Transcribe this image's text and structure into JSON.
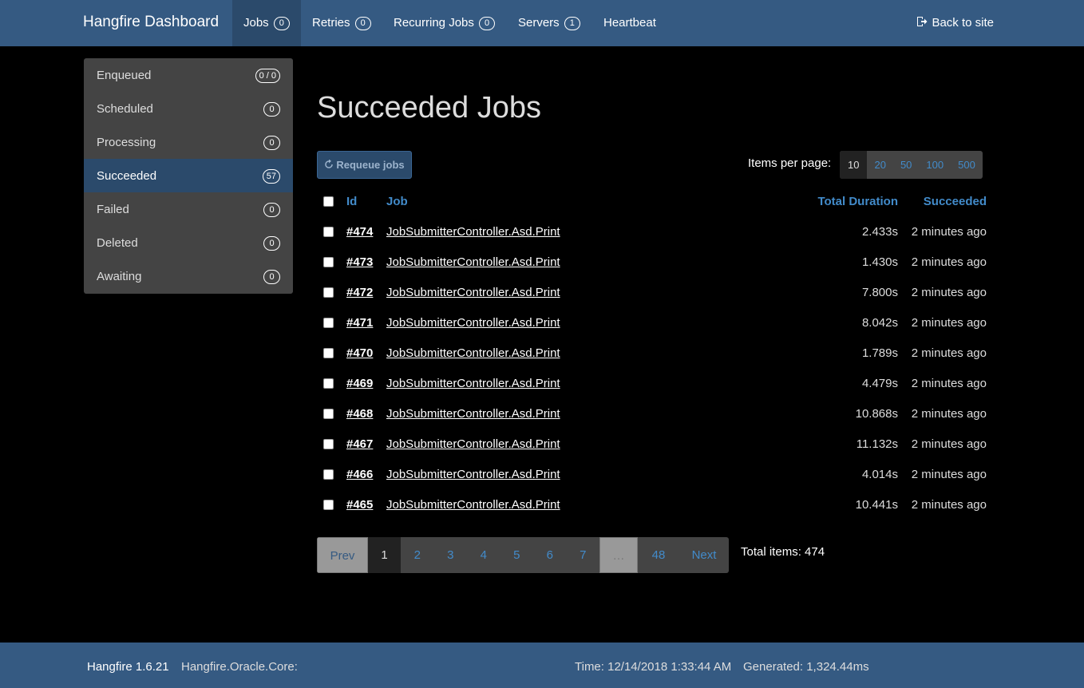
{
  "navbar": {
    "brand": "Hangfire Dashboard",
    "items": [
      {
        "label": "Jobs",
        "count": "0"
      },
      {
        "label": "Retries",
        "count": "0"
      },
      {
        "label": "Recurring Jobs",
        "count": "0"
      },
      {
        "label": "Servers",
        "count": "1"
      },
      {
        "label": "Heartbeat"
      }
    ],
    "back_label": "Back to site"
  },
  "sidebar": {
    "items": [
      {
        "label": "Enqueued",
        "count": "0 / 0"
      },
      {
        "label": "Scheduled",
        "count": "0"
      },
      {
        "label": "Processing",
        "count": "0"
      },
      {
        "label": "Succeeded",
        "count": "57"
      },
      {
        "label": "Failed",
        "count": "0"
      },
      {
        "label": "Deleted",
        "count": "0"
      },
      {
        "label": "Awaiting",
        "count": "0"
      }
    ]
  },
  "main": {
    "title": "Succeeded Jobs",
    "requeue_label": "Requeue jobs",
    "items_per_page_label": "Items per page:",
    "page_sizes": [
      "10",
      "20",
      "50",
      "100",
      "500"
    ],
    "table": {
      "headers": {
        "id": "Id",
        "job": "Job",
        "duration": "Total Duration",
        "succeeded": "Succeeded"
      },
      "rows": [
        {
          "id": "#474",
          "job": "JobSubmitterController.Asd.Print",
          "duration": "2.433s",
          "succeeded": "2 minutes ago"
        },
        {
          "id": "#473",
          "job": "JobSubmitterController.Asd.Print",
          "duration": "1.430s",
          "succeeded": "2 minutes ago"
        },
        {
          "id": "#472",
          "job": "JobSubmitterController.Asd.Print",
          "duration": "7.800s",
          "succeeded": "2 minutes ago"
        },
        {
          "id": "#471",
          "job": "JobSubmitterController.Asd.Print",
          "duration": "8.042s",
          "succeeded": "2 minutes ago"
        },
        {
          "id": "#470",
          "job": "JobSubmitterController.Asd.Print",
          "duration": "1.789s",
          "succeeded": "2 minutes ago"
        },
        {
          "id": "#469",
          "job": "JobSubmitterController.Asd.Print",
          "duration": "4.479s",
          "succeeded": "2 minutes ago"
        },
        {
          "id": "#468",
          "job": "JobSubmitterController.Asd.Print",
          "duration": "10.868s",
          "succeeded": "2 minutes ago"
        },
        {
          "id": "#467",
          "job": "JobSubmitterController.Asd.Print",
          "duration": "11.132s",
          "succeeded": "2 minutes ago"
        },
        {
          "id": "#466",
          "job": "JobSubmitterController.Asd.Print",
          "duration": "4.014s",
          "succeeded": "2 minutes ago"
        },
        {
          "id": "#465",
          "job": "JobSubmitterController.Asd.Print",
          "duration": "10.441s",
          "succeeded": "2 minutes ago"
        }
      ]
    },
    "pager": {
      "prev": "Prev",
      "pages": [
        "1",
        "2",
        "3",
        "4",
        "5",
        "6",
        "7"
      ],
      "ellipsis": "…",
      "last": "48",
      "next": "Next"
    },
    "total_items": "Total items: 474"
  },
  "footer": {
    "version": "Hangfire 1.6.21",
    "storage": "Hangfire.Oracle.Core:",
    "time": "Time: 12/14/2018 1:33:44 AM",
    "generated": "Generated: 1,324.44ms"
  },
  "colors": {
    "navbar": "#355a82",
    "active": "#2b4a6b",
    "link": "#428bca",
    "sidebar": "#444444",
    "background": "#000000"
  },
  "icons": {
    "back": "sign-out-icon",
    "requeue": "refresh-icon"
  }
}
